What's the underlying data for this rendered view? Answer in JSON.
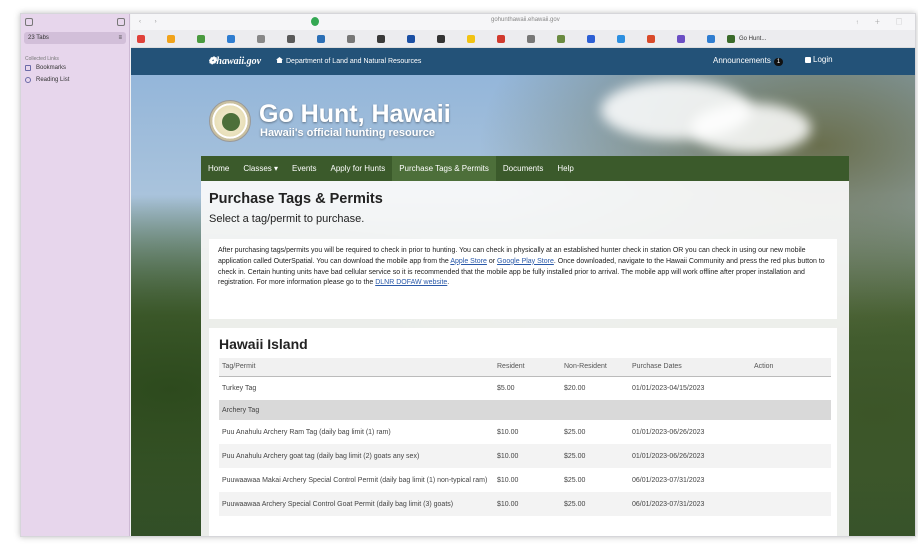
{
  "sidebar": {
    "tabs_label": "23 Tabs",
    "section_label": "Collected Links",
    "items": [
      {
        "label": "Bookmarks",
        "icon": "bookmark-icon"
      },
      {
        "label": "Reading List",
        "icon": "reading-list-icon"
      }
    ]
  },
  "browser": {
    "url": "gohunthawaii.ehawaii.gov",
    "active_tab_label": "Go Hunt...",
    "favorites_colors": [
      "#e0413a",
      "#f1a31b",
      "#4a9a3f",
      "#2f7dd0",
      "#888888",
      "#5a5a5a",
      "#2c6fb5",
      "#777777",
      "#3a3a3a",
      "#1b4fa3",
      "#333333",
      "#f2c313",
      "#d13a2e",
      "#777777",
      "#6a8a40",
      "#2d5fd4",
      "#2d8fe0",
      "#d94a2a",
      "#6b4fc4",
      "#2f7dd0"
    ]
  },
  "site": {
    "logo_text": "hawaii.gov",
    "department": "Department of Land and Natural Resources",
    "announcements_label": "Announcements",
    "announcements_count": "1",
    "login_label": "Login",
    "title": "Go Hunt, Hawaii",
    "subtitle": "Hawaii's official hunting resource",
    "nav": [
      "Home",
      "Classes ▾",
      "Events",
      "Apply for Hunts",
      "Purchase Tags & Permits",
      "Documents",
      "Help"
    ],
    "active_nav": "Purchase Tags & Permits"
  },
  "page": {
    "title": "Purchase Tags & Permits",
    "subtitle": "Select a tag/permit to purchase.",
    "notice_1": "After purchasing tags/permits you will be required to check in prior to hunting. You can check in physically at an established hunter check in station OR you can check in using our new mobile application called OuterSpatial. You can download the mobile app from the ",
    "apple_link": "Apple Store",
    "notice_or": " or ",
    "google_link": "Google Play Store",
    "notice_2": ". Once downloaded, navigate to the Hawaii Community and press the red plus button to check in. Certain hunting units have bad cellular service so it is recommended that the mobile app be fully installed prior to arrival. The mobile app will work offline after proper installation and registration. For more information please go to the ",
    "dofaw_link": "DLNR DOFAW website",
    "notice_end": "."
  },
  "island": {
    "title": "Hawaii Island",
    "headers": [
      "Tag/Permit",
      "Resident",
      "Non-Resident",
      "Purchase Dates",
      "Action"
    ],
    "rows": [
      {
        "name": "Turkey Tag",
        "resident": "$5.00",
        "nonresident": "$20.00",
        "dates": "01/01/2023-04/15/2023"
      },
      {
        "group": "Archery Tag"
      },
      {
        "name": "Puu Anahulu Archery Ram Tag (daily bag limit (1) ram)",
        "resident": "$10.00",
        "nonresident": "$25.00",
        "dates": "01/01/2023-06/26/2023"
      },
      {
        "name": "Puu Anahulu Archery goat tag (daily bag limit (2) goats any sex)",
        "resident": "$10.00",
        "nonresident": "$25.00",
        "dates": "01/01/2023-06/26/2023"
      },
      {
        "name": "Puuwaawaa Makai Archery Special Control Permit (daily bag limit (1) non-typical ram)",
        "resident": "$10.00",
        "nonresident": "$25.00",
        "dates": "06/01/2023-07/31/2023"
      },
      {
        "name": "Puuwaawaa Archery Special Control Goat Permit (daily bag limit (3) goats)",
        "resident": "$10.00",
        "nonresident": "$25.00",
        "dates": "06/01/2023-07/31/2023"
      }
    ]
  }
}
